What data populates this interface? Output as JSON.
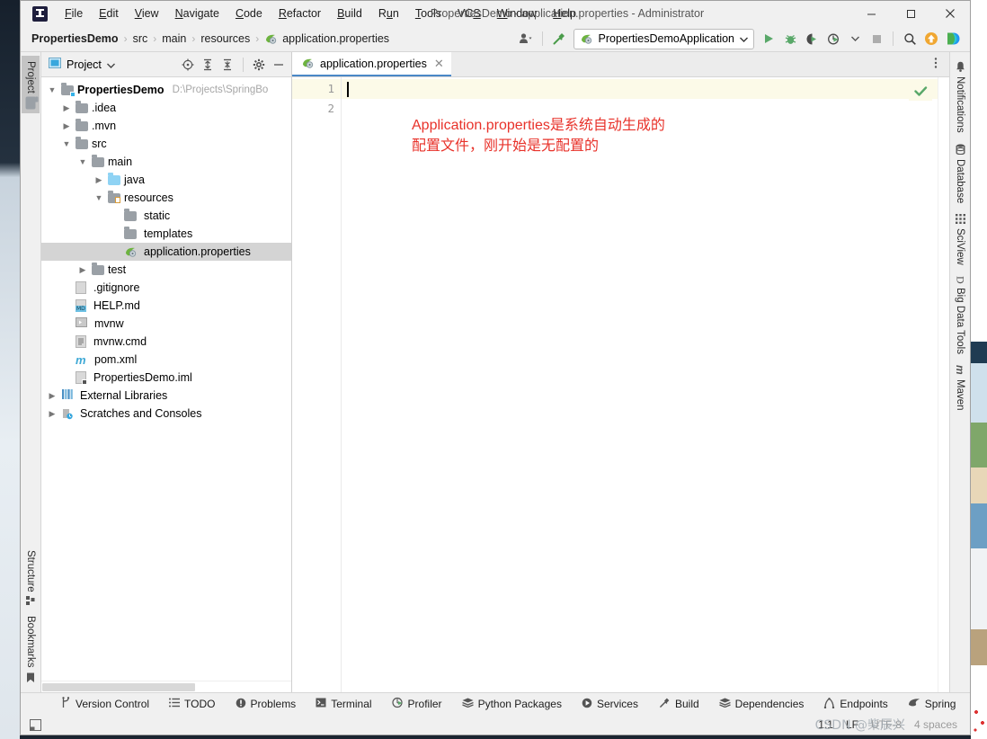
{
  "window": {
    "title": "PropertiesDemo - application.properties - Administrator",
    "logo_icon": "intellij-idea-logo",
    "minimize_icon": "minimize-icon",
    "maximize_icon": "maximize-icon",
    "close_icon": "close-icon"
  },
  "menu": [
    {
      "label": "File",
      "mnemonic": "F"
    },
    {
      "label": "Edit",
      "mnemonic": "E"
    },
    {
      "label": "View",
      "mnemonic": "V"
    },
    {
      "label": "Navigate",
      "mnemonic": "N"
    },
    {
      "label": "Code",
      "mnemonic": "C"
    },
    {
      "label": "Refactor",
      "mnemonic": "R"
    },
    {
      "label": "Build",
      "mnemonic": "B"
    },
    {
      "label": "Run",
      "mnemonic": "u"
    },
    {
      "label": "Tools",
      "mnemonic": "T"
    },
    {
      "label": "VCS",
      "mnemonic": "S"
    },
    {
      "label": "Window",
      "mnemonic": "W"
    },
    {
      "label": "Help",
      "mnemonic": "H"
    }
  ],
  "navbar": {
    "breadcrumbs": [
      "PropertiesDemo",
      "src",
      "main",
      "resources",
      "application.properties"
    ],
    "separator": "›",
    "file_icon": "spring-properties-icon",
    "run_config": {
      "name": "PropertiesDemoApplication",
      "icon": "spring-boot-icon",
      "dropdown_icon": "chevron-down-icon"
    },
    "buttons": {
      "user_icon": "user-settings-icon",
      "build_icon": "hammer-build-icon",
      "run_icon": "run-icon",
      "debug_icon": "debug-icon",
      "run_coverage_icon": "run-with-coverage-icon",
      "profile_icon": "profile-icon",
      "stop_icon": "stop-icon",
      "search_icon": "search-everywhere-icon",
      "update_icon": "update-project-icon",
      "ide_feature_icon": "ide-features-trainer-icon"
    }
  },
  "left_strip": {
    "top": [
      {
        "label": "Project",
        "icon": "project-folder-icon",
        "active": true
      }
    ],
    "bottom": [
      {
        "label": "Structure",
        "icon": "structure-icon",
        "active": false
      },
      {
        "label": "Bookmarks",
        "icon": "bookmarks-icon",
        "active": false
      }
    ]
  },
  "right_strip": [
    {
      "label": "Notifications",
      "icon": "bell-icon"
    },
    {
      "label": "Database",
      "icon": "database-icon"
    },
    {
      "label": "SciView",
      "icon": "sciview-grid-icon"
    },
    {
      "label": "Big Data Tools",
      "icon": "big-data-tools-icon"
    },
    {
      "label": "Maven",
      "icon": "maven-icon"
    }
  ],
  "project_panel": {
    "title": "Project",
    "title_dropdown_icon": "chevron-down-icon",
    "icons": {
      "view_icon": "project-view-icon",
      "locate_icon": "select-opened-file-icon",
      "expand_icon": "expand-all-icon",
      "collapse_icon": "collapse-all-icon",
      "settings_icon": "gear-icon",
      "hide_icon": "hide-panel-icon"
    },
    "tree": [
      {
        "label": "PropertiesDemo",
        "path": "D:\\Projects\\SpringBo",
        "indent": 0,
        "chevron": "down",
        "icon": "module-folder-icon",
        "bold": true,
        "selected": false
      },
      {
        "label": ".idea",
        "indent": 1,
        "chevron": "right",
        "icon": "folder-icon",
        "selected": false
      },
      {
        "label": ".mvn",
        "indent": 1,
        "chevron": "right",
        "icon": "folder-icon",
        "selected": false
      },
      {
        "label": "src",
        "indent": 1,
        "chevron": "down",
        "icon": "folder-icon",
        "selected": false
      },
      {
        "label": "main",
        "indent": 2,
        "chevron": "down",
        "icon": "folder-icon",
        "selected": false
      },
      {
        "label": "java",
        "indent": 3,
        "chevron": "right",
        "icon": "source-folder-icon",
        "selected": false
      },
      {
        "label": "resources",
        "indent": 3,
        "chevron": "down",
        "icon": "resources-folder-icon",
        "selected": false
      },
      {
        "label": "static",
        "indent": 4,
        "chevron": "none",
        "icon": "folder-icon",
        "selected": false
      },
      {
        "label": "templates",
        "indent": 4,
        "chevron": "none",
        "icon": "folder-icon",
        "selected": false
      },
      {
        "label": "application.properties",
        "indent": 4,
        "chevron": "none",
        "icon": "spring-properties-icon",
        "selected": true
      },
      {
        "label": "test",
        "indent": 2,
        "chevron": "right",
        "icon": "folder-icon",
        "selected": false
      },
      {
        "label": ".gitignore",
        "indent": 1,
        "chevron": "none",
        "icon": "gitignore-file-icon",
        "selected": false
      },
      {
        "label": "HELP.md",
        "indent": 1,
        "chevron": "none",
        "icon": "markdown-file-icon",
        "selected": false
      },
      {
        "label": "mvnw",
        "indent": 1,
        "chevron": "none",
        "icon": "script-file-icon",
        "selected": false
      },
      {
        "label": "mvnw.cmd",
        "indent": 1,
        "chevron": "none",
        "icon": "cmd-file-icon",
        "selected": false
      },
      {
        "label": "pom.xml",
        "indent": 1,
        "chevron": "none",
        "icon": "maven-pom-icon",
        "selected": false
      },
      {
        "label": "PropertiesDemo.iml",
        "indent": 1,
        "chevron": "none",
        "icon": "iml-file-icon",
        "selected": false
      },
      {
        "label": "External Libraries",
        "indent": 0,
        "chevron": "right",
        "icon": "external-libraries-icon",
        "selected": false
      },
      {
        "label": "Scratches and Consoles",
        "indent": 0,
        "chevron": "right",
        "icon": "scratches-icon",
        "selected": false
      }
    ]
  },
  "editor": {
    "tab": {
      "label": "application.properties",
      "icon": "spring-properties-icon",
      "close_icon": "close-icon"
    },
    "options_icon": "editor-options-icon",
    "line_numbers": [
      "1",
      "2"
    ],
    "current_line": 1,
    "content_lines": [
      "",
      ""
    ],
    "annotation": "Application.properties是系统自动生成的\n配置文件，刚开始是无配置的",
    "annotation_color": "#e8322a",
    "inspection_icon": "inspection-ok-checkmark-icon"
  },
  "toolwindow_bar": [
    {
      "label": "Version Control",
      "icon": "branch-icon"
    },
    {
      "label": "TODO",
      "icon": "todo-list-icon"
    },
    {
      "label": "Problems",
      "icon": "problems-icon"
    },
    {
      "label": "Terminal",
      "icon": "terminal-icon"
    },
    {
      "label": "Profiler",
      "icon": "profiler-icon"
    },
    {
      "label": "Python Packages",
      "icon": "python-packages-icon"
    },
    {
      "label": "Services",
      "icon": "services-icon"
    },
    {
      "label": "Build",
      "icon": "hammer-build-icon"
    },
    {
      "label": "Dependencies",
      "icon": "dependencies-icon"
    },
    {
      "label": "Endpoints",
      "icon": "endpoints-icon"
    },
    {
      "label": "Spring",
      "icon": "spring-leaf-icon"
    }
  ],
  "statusbar": {
    "caret_position": "1:1",
    "line_separator": "LF",
    "encoding": "UTF-8",
    "indent": "4 spaces",
    "watermark": "CSDN @柴辰兴",
    "layout_icon": "layout-toggle-icon"
  }
}
